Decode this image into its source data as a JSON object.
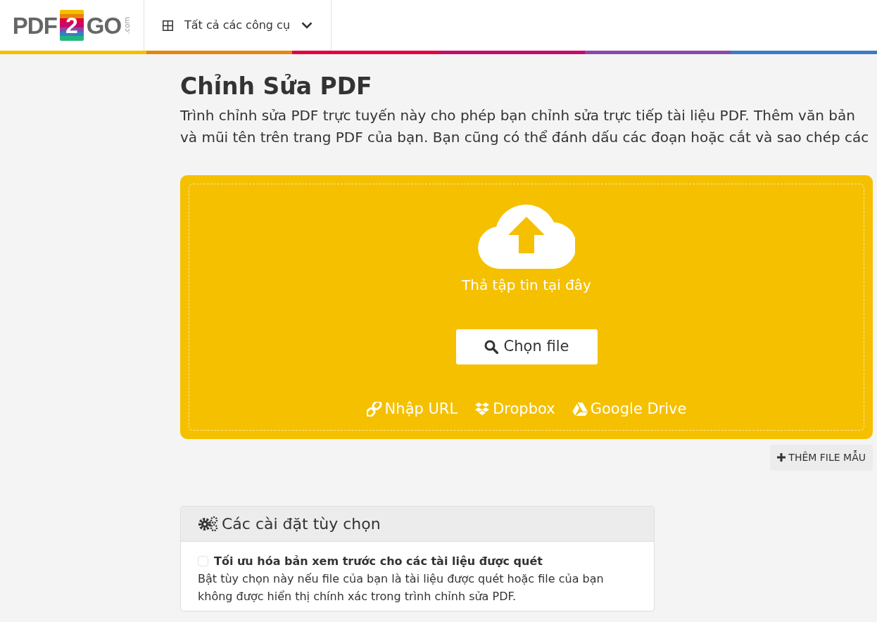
{
  "header": {
    "logo": {
      "left": "PDF",
      "middle": "2",
      "right": "GO",
      "suffix": ".com"
    },
    "tools_menu": {
      "label": "Tất cả các công cụ",
      "expanded": false
    }
  },
  "color_bar": [
    {
      "color": "#f5be00"
    },
    {
      "color": "#e5870a"
    },
    {
      "color": "#e2003e"
    },
    {
      "color": "#c50a6b"
    },
    {
      "color": "#8d47a6"
    },
    {
      "color": "#3b7bc5"
    }
  ],
  "title": "Chỉnh Sửa PDF",
  "description_lines": [
    "Trình chỉnh sửa PDF trực tuyến này cho phép bạn chỉnh sửa trực tiếp tài liệu PDF. Thêm văn bản",
    "và mũi tên trên trang PDF của bạn. Bạn cũng có thể đánh dấu các đoạn hoặc cắt và sao chép các"
  ],
  "upload": {
    "drop_text": "Thả tập tin tại đây",
    "choose_button": "Chọn file",
    "sources": [
      {
        "kind": "url",
        "label": "Nhập URL"
      },
      {
        "kind": "dropbox",
        "label": "Dropbox"
      },
      {
        "kind": "gdrive",
        "label": "Google Drive"
      }
    ]
  },
  "sample_button": "THÊM FILE MẪU",
  "settings": {
    "title": "Các cài đặt tùy chọn",
    "options": [
      {
        "label": "Tối ưu hóa bản xem trước cho các tài liệu được quét",
        "checked": false,
        "help": "Bật tùy chọn này nếu file của bạn là tài liệu được quét hoặc file của bạn không được hiển thị chính xác trong trình chỉnh sửa PDF."
      }
    ]
  }
}
